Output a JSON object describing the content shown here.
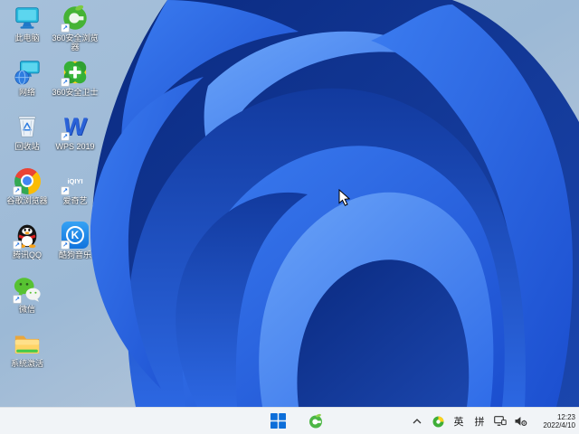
{
  "colors": {
    "wallpaper_top": "#a6c0da",
    "wallpaper_bottom": "#c6cfdb",
    "bloom_bright": "#2f6fe8",
    "bloom_dark": "#0c2e8c",
    "taskbar_bg": "#f1f4f7",
    "accent_blue": "#0d6ed9"
  },
  "desktop": {
    "icons": [
      {
        "label": "此电脑",
        "name": "this-pc",
        "shortcut": false
      },
      {
        "label": "360安全浏览器",
        "name": "360-safe-browser",
        "shortcut": true
      },
      {
        "label": "网络",
        "name": "network",
        "shortcut": false
      },
      {
        "label": "360安全卫士",
        "name": "360-security-guard",
        "shortcut": true
      },
      {
        "label": "回收站",
        "name": "recycle-bin",
        "shortcut": false
      },
      {
        "label": "WPS 2019",
        "name": "wps-2019",
        "shortcut": true
      },
      {
        "label": "谷歌浏览器",
        "name": "chrome",
        "shortcut": true
      },
      {
        "label": "爱奇艺",
        "name": "iqiyi",
        "shortcut": true
      },
      {
        "label": "腾讯QQ",
        "name": "tencent-qq",
        "shortcut": true
      },
      {
        "label": "酷狗音乐",
        "name": "kugou-music",
        "shortcut": true
      },
      {
        "label": "微信",
        "name": "wechat",
        "shortcut": true
      },
      {
        "label": "系统激活",
        "name": "activation-folder",
        "shortcut": false
      }
    ],
    "glyphs": {
      "iqiyi": "iQIYI",
      "kugou": "K",
      "wps": "W"
    }
  },
  "taskbar": {
    "tray": {
      "ime_lang": "英",
      "ime_mode": "拼"
    },
    "clock": {
      "time": "12:23",
      "date": "2022/4/10"
    }
  }
}
